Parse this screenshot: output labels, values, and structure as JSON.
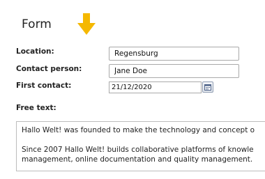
{
  "form": {
    "title": "Form"
  },
  "fields": {
    "location": {
      "label": "Location:",
      "value": "Regensburg"
    },
    "contact_person": {
      "label": "Contact person:",
      "value": "Jane Doe"
    },
    "first_contact": {
      "label": "First contact:",
      "value": "21/12/2020"
    },
    "free_text": {
      "label": "Free text:",
      "paragraphs": [
        "Hallo Welt! was founded to make the technology and concept o",
        "Since 2007 Hallo Welt! builds collaborative platforms of knowle",
        "management, online documentation and quality management."
      ]
    }
  },
  "icons": {
    "arrow": "arrow-down-icon",
    "calendar": "calendar-icon"
  },
  "colors": {
    "arrow": "#f5b800"
  }
}
